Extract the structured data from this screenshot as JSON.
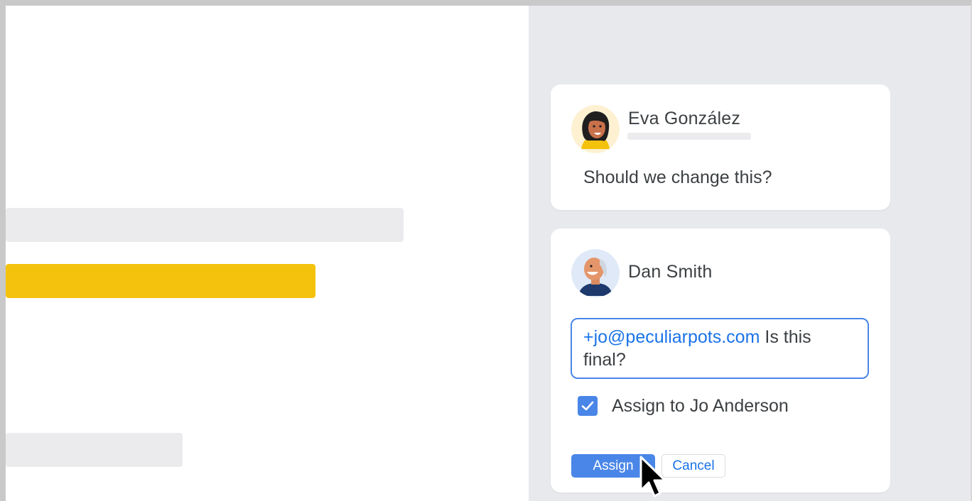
{
  "document": {
    "lines": [
      {
        "kind": "text-placeholder"
      },
      {
        "kind": "highlighted-text"
      },
      {
        "kind": "text-placeholder"
      }
    ]
  },
  "comments": [
    {
      "author": "Eva González",
      "avatar_icon": "woman-avatar-icon",
      "text": "Should we change this?"
    }
  ],
  "reply": {
    "author": "Dan Smith",
    "avatar_icon": "man-avatar-icon",
    "mention": "+jo@peculiarpots.com",
    "text": " Is this final?",
    "assign_checked": true,
    "assign_label": "Assign to Jo Anderson",
    "assign_button": "Assign",
    "cancel_button": "Cancel"
  },
  "colors": {
    "accent": "#4a86e8",
    "link": "#1a73e8",
    "highlight": "#f4c20d",
    "sidebar_bg": "#e8e9ec"
  },
  "icons": {
    "checkbox": "check-icon",
    "cursor": "mouse-pointer-icon"
  }
}
